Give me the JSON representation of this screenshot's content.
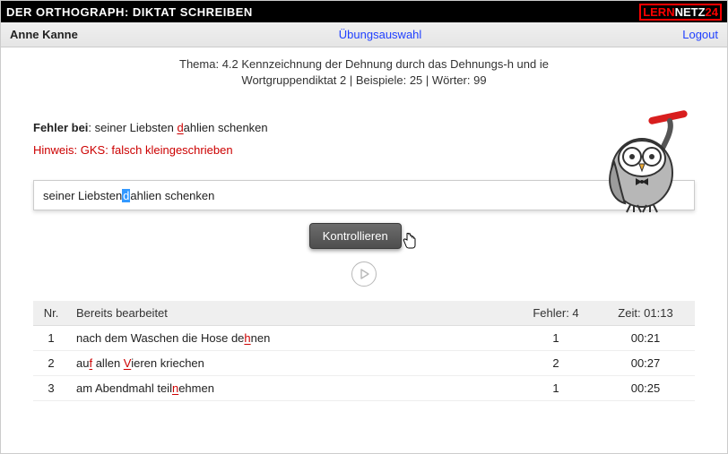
{
  "header": {
    "title": "DER ORTHOGRAPH: DIKTAT SCHREIBEN",
    "logo1": "LERN",
    "logo2": "NETZ",
    "logo3": "24"
  },
  "subbar": {
    "user": "Anne Kanne",
    "exercise_select": "Übungsauswahl",
    "logout": "Logout"
  },
  "thema": {
    "line1": "Thema: 4.2 Kennzeichnung der Dehnung durch das Dehnungs-h und ie",
    "line2": "Wortgruppendiktat 2 | Beispiele: 25 | Wörter: 99"
  },
  "feedback": {
    "label": "Fehler bei",
    "before": ": seiner Liebsten ",
    "mark": "d",
    "after": "ahlien schenken",
    "hint": "Hinweis: GKS: falsch kleingeschrieben"
  },
  "input": {
    "before": "seiner Liebsten ",
    "selected": "d",
    "after": "ahlien schenken"
  },
  "buttons": {
    "check": "Kontrollieren"
  },
  "table": {
    "h_nr": "Nr.",
    "h_done": "Bereits bearbeitet",
    "h_err": "Fehler: 4",
    "h_time": "Zeit: 01:13",
    "rows": [
      {
        "nr": "1",
        "pre": "nach dem Waschen die Hose de",
        "u": "h",
        "post": "nen",
        "err": "1",
        "t": "00:21"
      },
      {
        "nr": "2",
        "pre": "au",
        "u": "f",
        "post": " allen ",
        "u2": "V",
        "post2": "ieren kriechen",
        "err": "2",
        "t": "00:27"
      },
      {
        "nr": "3",
        "pre": "am Abendmahl teil",
        "u": "n",
        "post": "ehmen",
        "err": "1",
        "t": "00:25"
      }
    ]
  }
}
